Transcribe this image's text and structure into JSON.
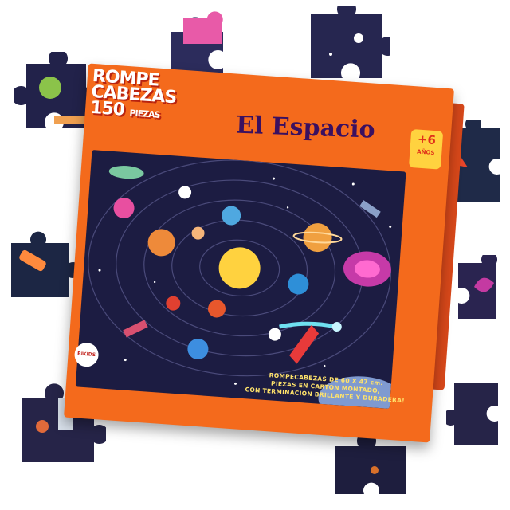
{
  "box": {
    "brand_line1": "ROMPE",
    "brand_line2": "CABEZAS",
    "brand_pieces_count": "150",
    "brand_pieces_word": "PIEZAS",
    "title": "El Espacio",
    "age_value": "+6",
    "age_unit": "AÑOS",
    "description_line1": "ROMPECABEZAS DE 60 X 47 cm.",
    "description_line2": "PIEZAS EN CARTON MONTADO,",
    "description_line3": "CON TERMINACION BRILLANTE Y DURADERA!",
    "logo_text": "BIKIDS"
  },
  "colors": {
    "box_orange": "#f46a1c",
    "space_navy": "#1c1c42",
    "title_purple": "#3a1060",
    "age_yellow": "#ffd23f",
    "sun_yellow": "#ffd23f"
  },
  "scene_elements": [
    "sun-icon",
    "planet-icon",
    "rocket-icon",
    "astronaut-icon",
    "satellite-icon",
    "galaxy-icon",
    "comet-icon",
    "alien-ufo-icon"
  ],
  "loose_pieces_count": 9
}
